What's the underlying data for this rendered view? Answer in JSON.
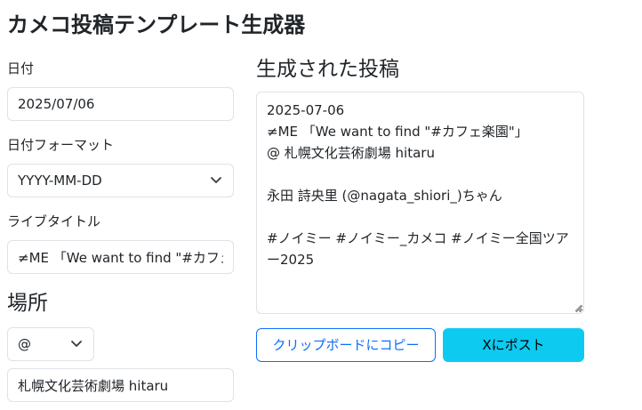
{
  "header": {
    "title": "カメコ投稿テンプレート生成器"
  },
  "form": {
    "date_label": "日付",
    "date_value": "2025/07/06",
    "format_label": "日付フォーマット",
    "format_selected": "YYYY-MM-DD",
    "live_title_label": "ライブタイトル",
    "live_title_value": "≠ME 「We want to find \"#カフェ楽園\"」",
    "venue_section_title": "場所",
    "venue_prefix_selected": "@",
    "venue_value": "札幌文化芸術劇場 hitaru"
  },
  "output": {
    "section_title": "生成された投稿",
    "generated_text": "2025-07-06\n≠ME 「We want to find \"#カフェ楽園\"」\n@ 札幌文化芸術劇場 hitaru\n\n永田 詩央里 (@nagata_shiori_)ちゃん\n\n#ノイミー #ノイミー_カメコ #ノイミー全国ツアー2025",
    "copy_button_label": "クリップボードにコピー",
    "post_button_label": "Xにポスト"
  },
  "colors": {
    "primary": "#0d6efd",
    "info": "#0dcaf0",
    "border": "#dee2e6",
    "text": "#212529"
  }
}
